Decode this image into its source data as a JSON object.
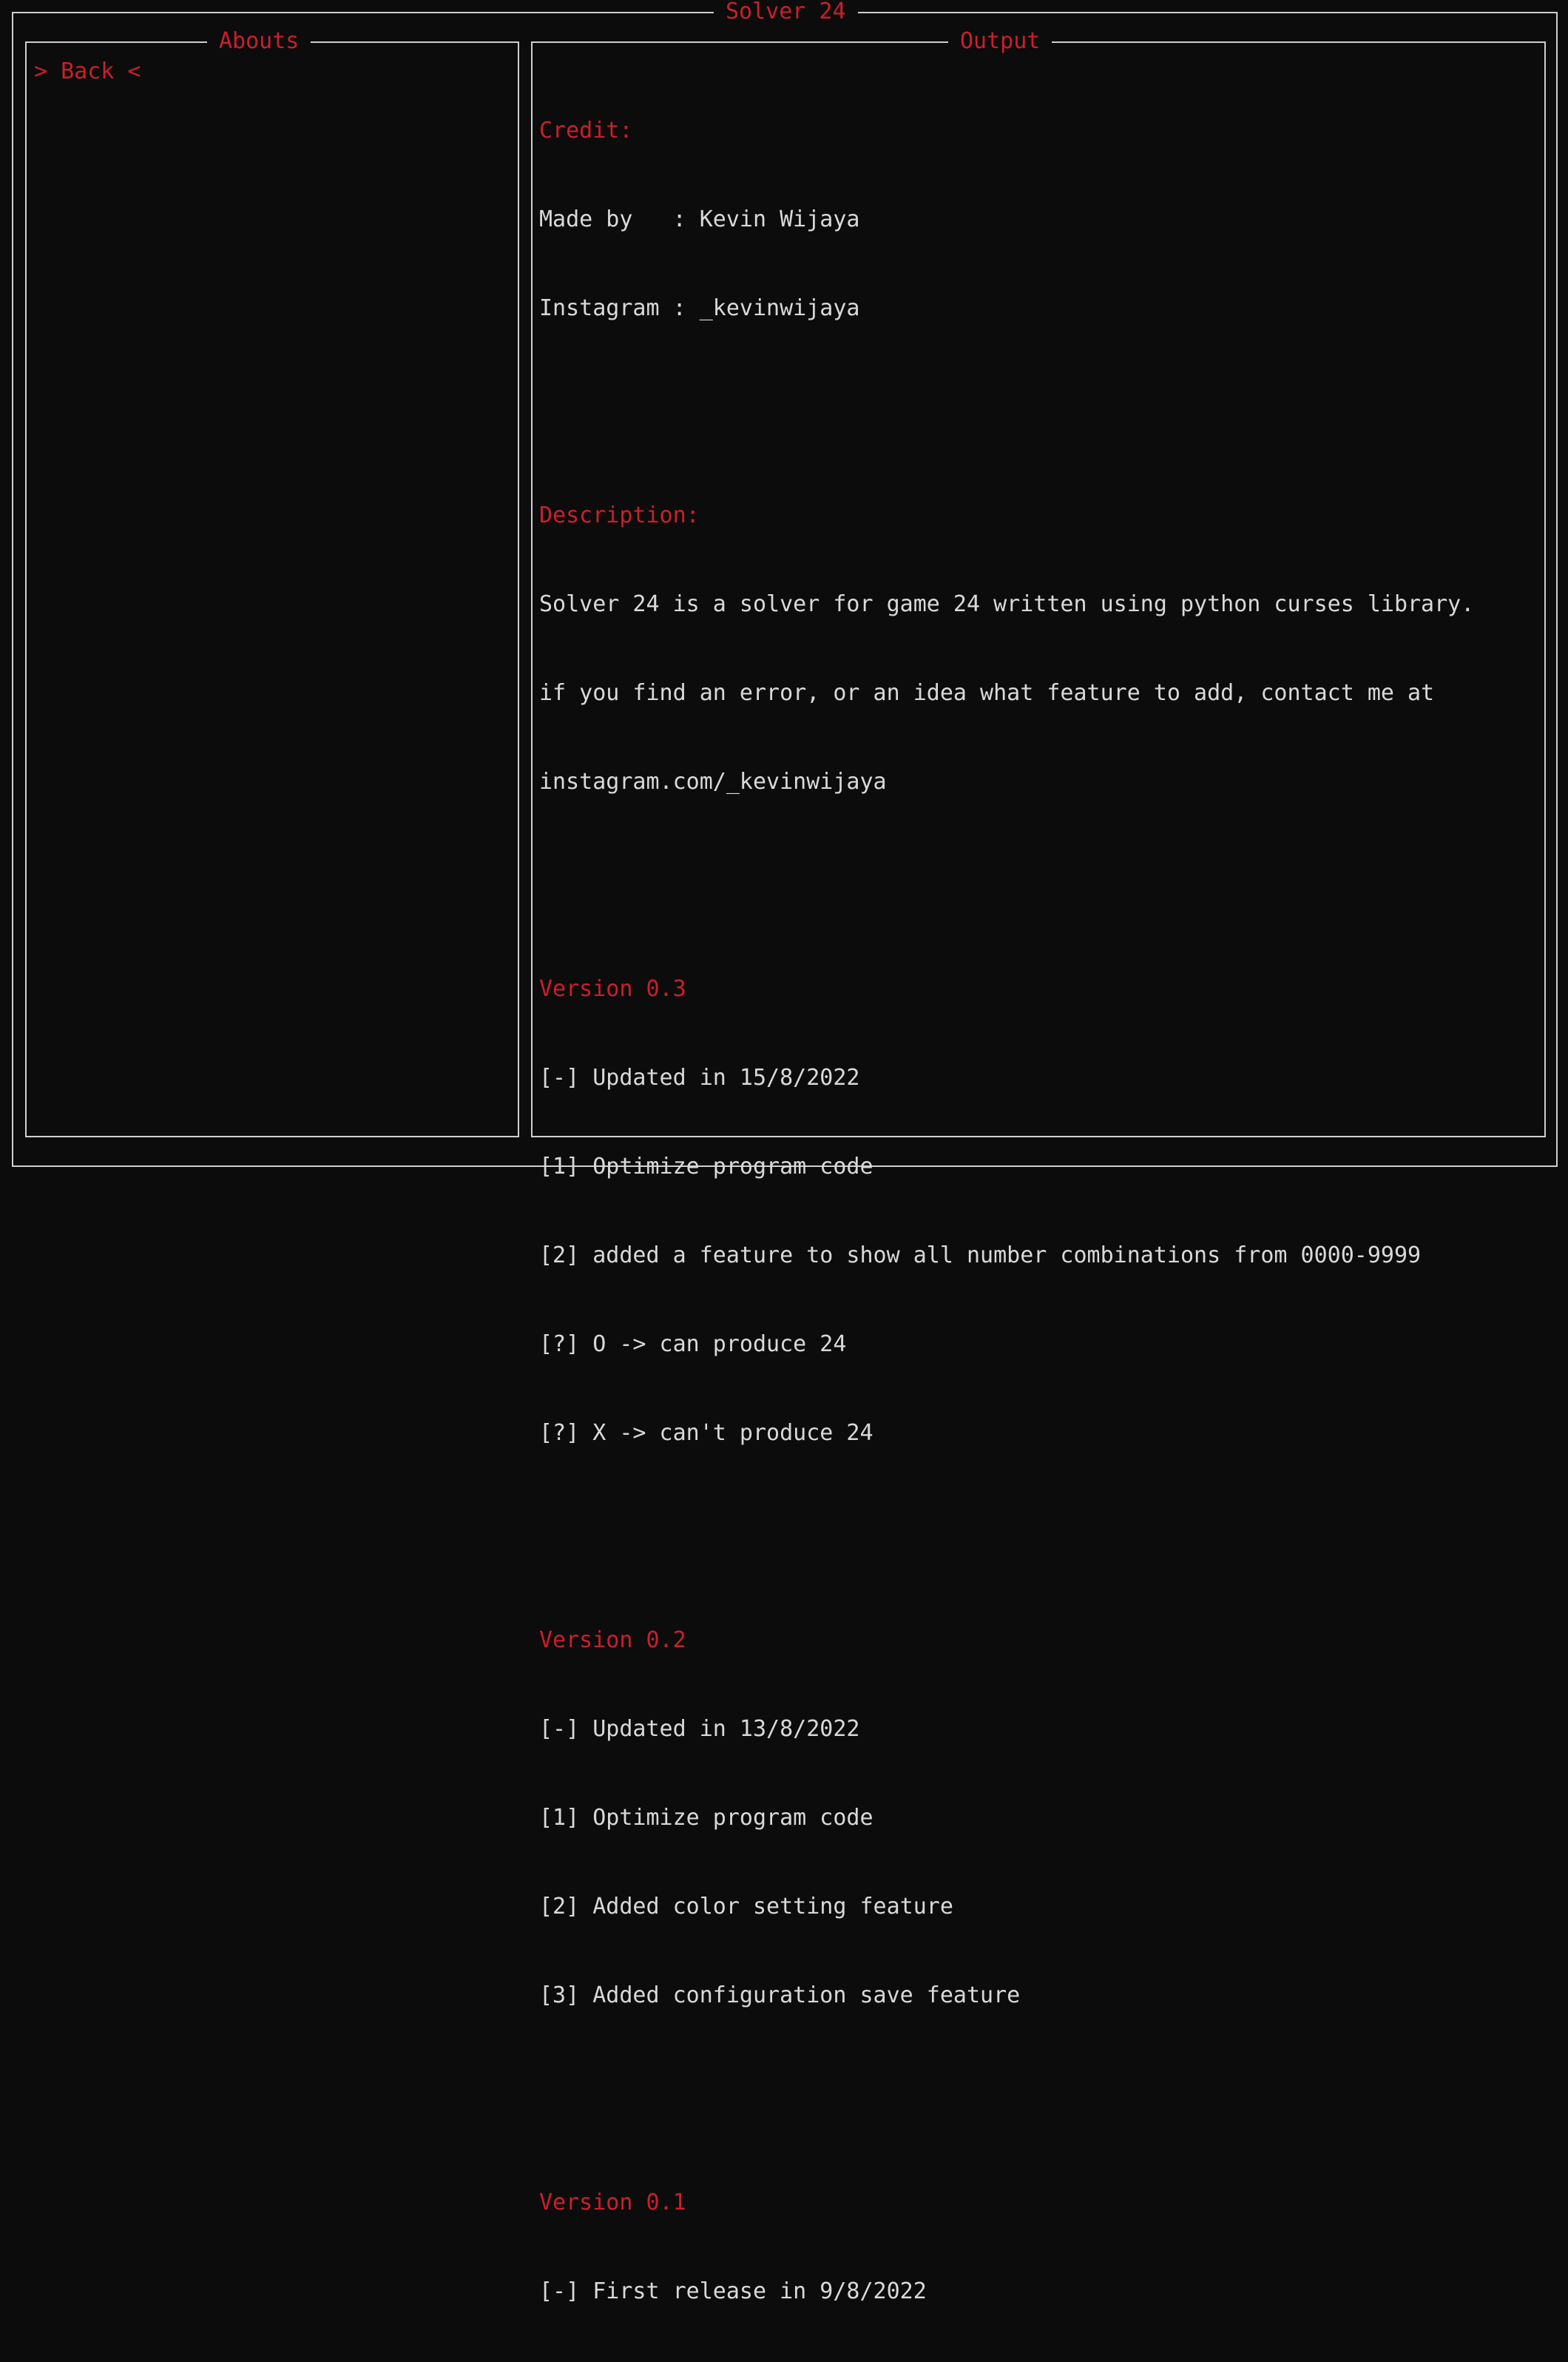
{
  "window": {
    "title": "Solver 24"
  },
  "left_panel": {
    "title": "Abouts",
    "menu": [
      {
        "label": "> Back <"
      }
    ]
  },
  "right_panel": {
    "title": "Output",
    "credit": {
      "header": "Credit:",
      "lines": [
        "Made by   : Kevin Wijaya",
        "Instagram : _kevinwijaya"
      ]
    },
    "description": {
      "header": "Description:",
      "lines": [
        "Solver 24 is a solver for game 24 written using python curses library.",
        "if you find an error, or an idea what feature to add, contact me at",
        "instagram.com/_kevinwijaya"
      ]
    },
    "versions": [
      {
        "header": "Version 0.3",
        "lines": [
          "[-] Updated in 15/8/2022",
          "[1] Optimize program code",
          "[2] added a feature to show all number combinations from 0000-9999",
          "[?] O -> can produce 24",
          "[?] X -> can't produce 24"
        ]
      },
      {
        "header": "Version 0.2",
        "lines": [
          "[-] Updated in 13/8/2022",
          "[1] Optimize program code",
          "[2] Added color setting feature",
          "[3] Added configuration save feature"
        ]
      },
      {
        "header": "Version 0.1",
        "lines": [
          "[-] First release in 9/8/2022"
        ]
      }
    ]
  },
  "colors": {
    "background": "#0c0c0c",
    "accent": "#cc1f2a",
    "text": "#d9d9d9",
    "border": "#cfcfcf"
  }
}
